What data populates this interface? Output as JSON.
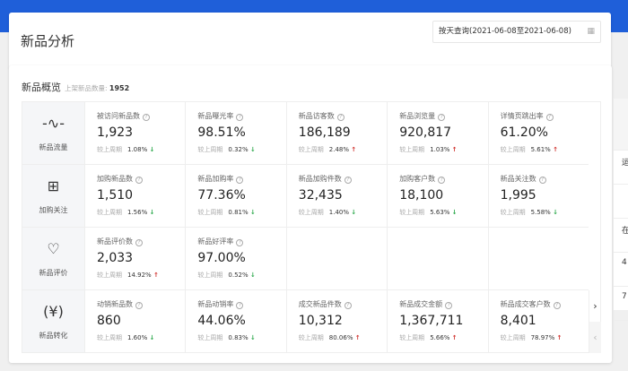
{
  "header": {
    "title": "新品分析",
    "date_range": "按天查询(2021-06-08至2021-06-08)",
    "calendar_icon": "calendar-icon"
  },
  "overview": {
    "title": "新品概览",
    "listed_label": "上架新品数量:",
    "listed_count": "1952",
    "compare_label": "较上周期",
    "rows": [
      {
        "label": "新品流量",
        "icon": "pulse-icon",
        "cells": [
          {
            "name": "被访问新品数",
            "value": "1,923",
            "change": "1.08%",
            "dir": "down"
          },
          {
            "name": "新品曝光率",
            "value": "98.51%",
            "change": "0.32%",
            "dir": "down"
          },
          {
            "name": "新品访客数",
            "value": "186,189",
            "change": "2.48%",
            "dir": "up"
          },
          {
            "name": "新品浏览量",
            "value": "920,817",
            "change": "1.03%",
            "dir": "up"
          },
          {
            "name": "详情页跳出率",
            "value": "61.20%",
            "change": "5.61%",
            "dir": "up"
          }
        ]
      },
      {
        "label": "加购关注",
        "icon": "cart-add-icon",
        "cells": [
          {
            "name": "加购新品数",
            "value": "1,510",
            "change": "1.56%",
            "dir": "down"
          },
          {
            "name": "新品加购率",
            "value": "77.36%",
            "change": "0.81%",
            "dir": "down"
          },
          {
            "name": "新品加购件数",
            "value": "32,435",
            "change": "1.40%",
            "dir": "down"
          },
          {
            "name": "加购客户数",
            "value": "18,100",
            "change": "5.63%",
            "dir": "down"
          },
          {
            "name": "新品关注数",
            "value": "1,995",
            "change": "5.58%",
            "dir": "down"
          }
        ]
      },
      {
        "label": "新品评价",
        "icon": "heart-icon",
        "cells": [
          {
            "name": "新品评价数",
            "value": "2,033",
            "change": "14.92%",
            "dir": "up"
          },
          {
            "name": "新品好评率",
            "value": "97.00%",
            "change": "0.52%",
            "dir": "down"
          }
        ]
      },
      {
        "label": "新品转化",
        "icon": "yuan-icon",
        "cells": [
          {
            "name": "动销新品数",
            "value": "860",
            "change": "1.60%",
            "dir": "down"
          },
          {
            "name": "新品动销率",
            "value": "44.06%",
            "change": "0.83%",
            "dir": "down"
          },
          {
            "name": "成交新品件数",
            "value": "10,312",
            "change": "80.06%",
            "dir": "up"
          },
          {
            "name": "新品成交金额",
            "value": "1,367,711",
            "change": "5.66%",
            "dir": "up"
          },
          {
            "name": "新品成交客户数",
            "value": "8,401",
            "change": "78.97%",
            "dir": "up"
          }
        ]
      }
    ]
  },
  "nav": {
    "next": "›",
    "prev": "‹"
  },
  "side_panel": [
    "运",
    "",
    "在",
    "4",
    "7"
  ],
  "colors": {
    "brand": "#1f5fd9",
    "up": "#d0312d",
    "down": "#2aa84a"
  }
}
